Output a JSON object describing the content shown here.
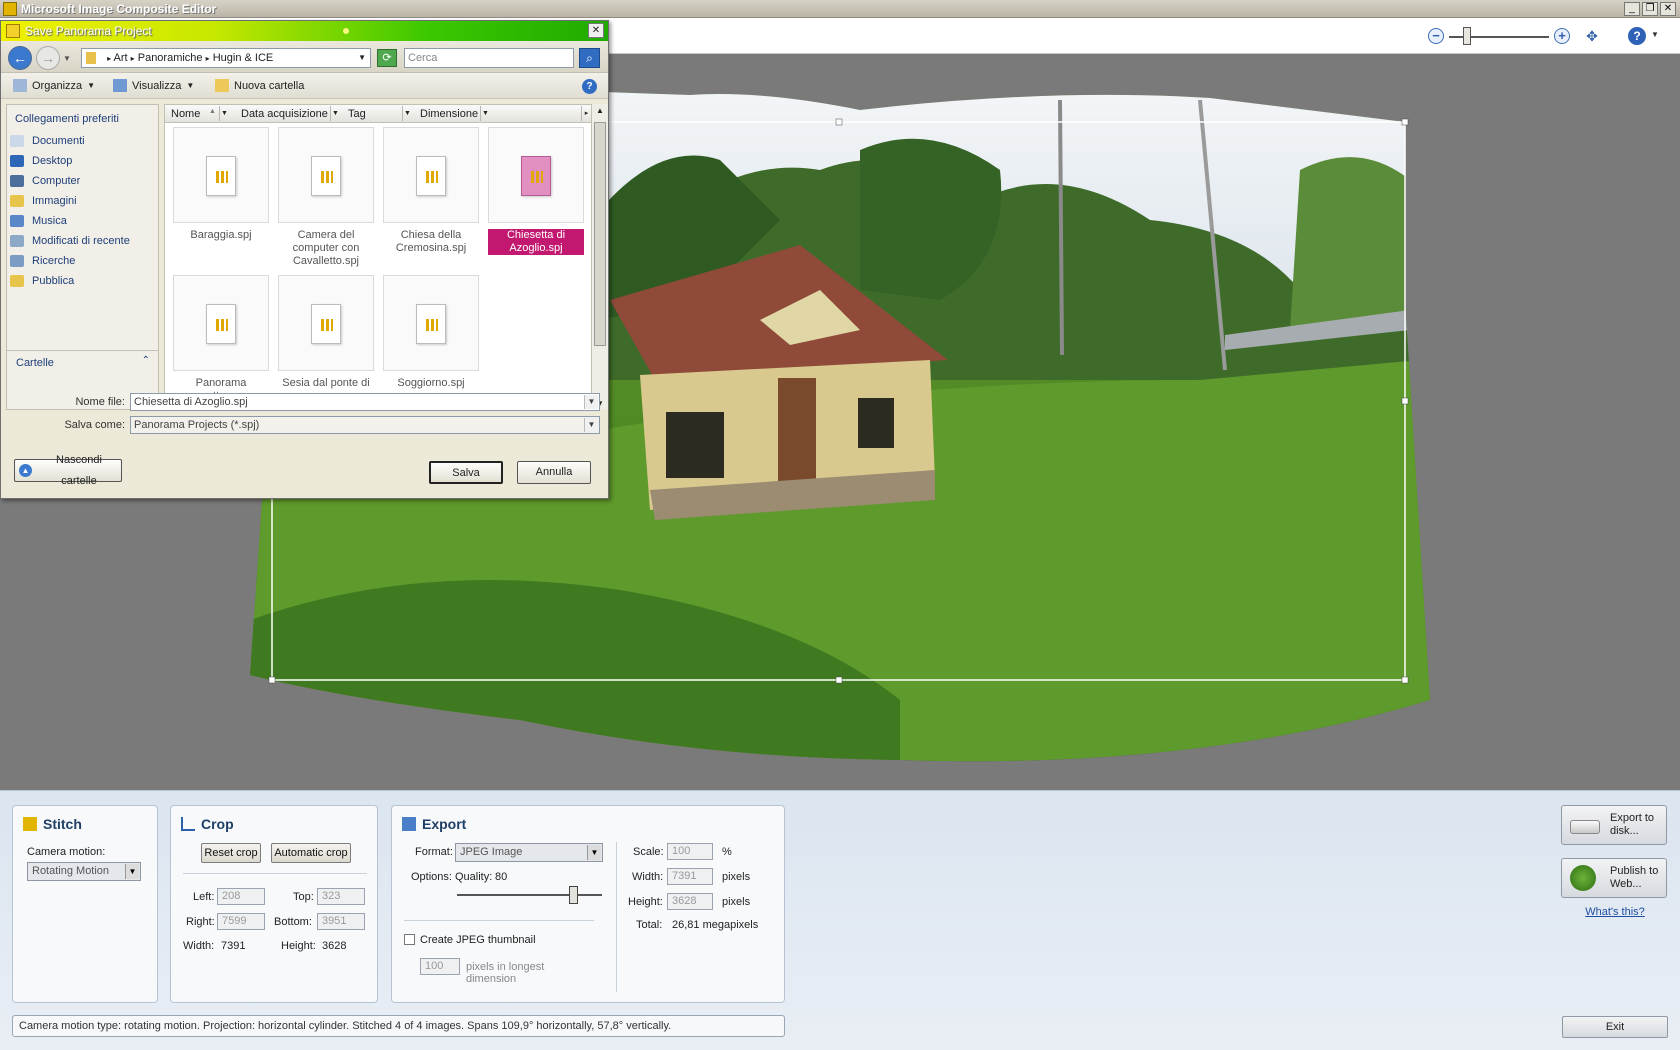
{
  "window": {
    "title": "Microsoft Image Composite Editor"
  },
  "dialog": {
    "title": "Save Panorama Project",
    "breadcrumb": [
      "Art",
      "Panoramiche",
      "Hugin & ICE"
    ],
    "search_placeholder": "Cerca",
    "commands": {
      "organize": "Organizza",
      "view": "Visualizza",
      "new_folder": "Nuova cartella"
    },
    "favorites_title": "Collegamenti preferiti",
    "favorites": [
      "Documenti",
      "Desktop",
      "Computer",
      "Immagini",
      "Musica",
      "Modificati di recente",
      "Ricerche",
      "Pubblica"
    ],
    "folders_label": "Cartelle",
    "columns": [
      "Nome",
      "Data acquisizione",
      "Tag",
      "Dimensione"
    ],
    "files": [
      {
        "name": "Baraggia.spj",
        "selected": false
      },
      {
        "name": "Camera del computer con Cavalletto.spj",
        "selected": false
      },
      {
        "name": "Chiesa della Cremosina.spj",
        "selected": false
      },
      {
        "name": "Chiesetta di Azoglio.spj",
        "selected": true
      },
      {
        "name": "Panorama notturno",
        "selected": false
      },
      {
        "name": "Sesia dal ponte di",
        "selected": false
      },
      {
        "name": "Soggiorno.spj",
        "selected": false
      }
    ],
    "filename_label": "Nome file:",
    "filename_value": "Chiesetta di Azoglio.spj",
    "savetype_label": "Salva come:",
    "savetype_value": "Panorama Projects (*.spj)",
    "hide_folders": "Nascondi cartelle",
    "save": "Salva",
    "cancel": "Annulla"
  },
  "stitch": {
    "title": "Stitch",
    "camera_motion_label": "Camera motion:",
    "camera_motion_value": "Rotating Motion"
  },
  "crop": {
    "title": "Crop",
    "reset": "Reset crop",
    "auto": "Automatic crop",
    "left_label": "Left:",
    "left": "208",
    "top_label": "Top:",
    "top": "323",
    "right_label": "Right:",
    "right": "7599",
    "bottom_label": "Bottom:",
    "bottom": "3951",
    "width_label": "Width:",
    "width": "7391",
    "height_label": "Height:",
    "height": "3628"
  },
  "export": {
    "title": "Export",
    "format_label": "Format:",
    "format_value": "JPEG Image",
    "options_label": "Options:",
    "quality_label": "Quality:",
    "quality": "80",
    "quality_fraction": 0.8,
    "thumb_label": "Create JPEG thumbnail",
    "thumb_size": "100",
    "thumb_unit": "pixels in longest dimension",
    "scale_label": "Scale:",
    "scale": "100",
    "scale_unit": "%",
    "width_label": "Width:",
    "width": "7391",
    "px": "pixels",
    "height_label": "Height:",
    "height": "3628",
    "total_label": "Total:",
    "total": "26,81 megapixels"
  },
  "actions": {
    "export_disk": "Export to disk...",
    "publish_web": "Publish to Web...",
    "whats_this": "What's this?",
    "exit": "Exit"
  },
  "status": "Camera motion type: rotating motion. Projection: horizontal cylinder. Stitched 4 of 4 images. Spans 109,9° horizontally, 57,8° vertically."
}
